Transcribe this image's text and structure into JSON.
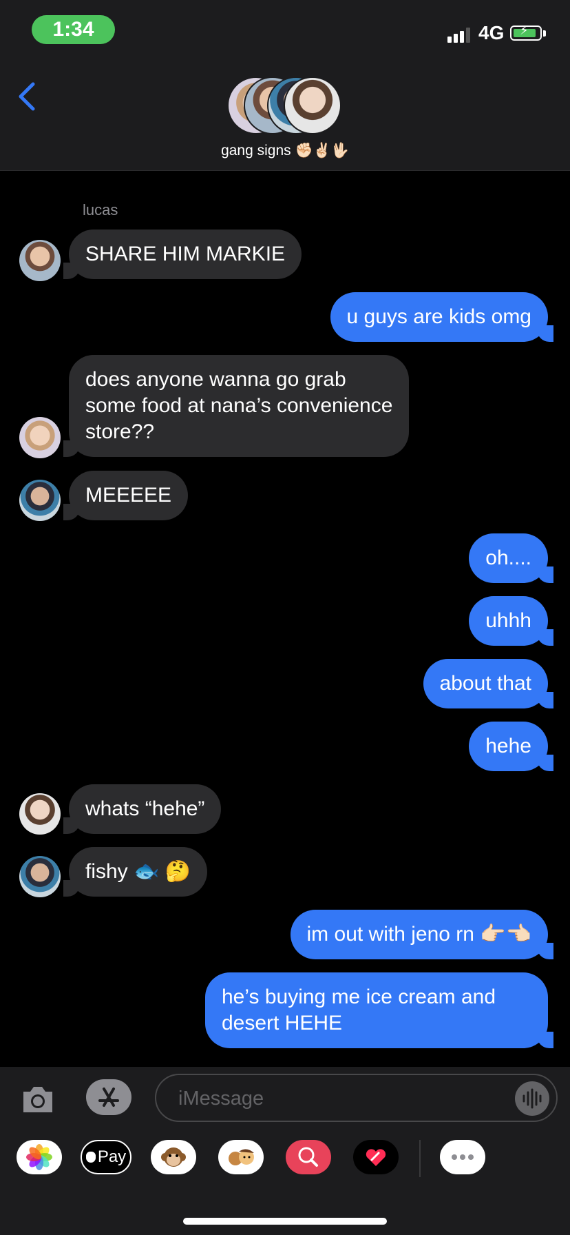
{
  "status_bar": {
    "time": "1:34",
    "network": "4G"
  },
  "header": {
    "group_name": "gang signs ✊🏻✌🏻🖖🏻",
    "back_icon": "chevron-left-icon"
  },
  "conversation": {
    "sender_label": "lucas",
    "messages": [
      {
        "direction": "in",
        "text": "SHARE HIM MARKIE"
      },
      {
        "direction": "out",
        "text": "u guys are kids omg"
      },
      {
        "direction": "in",
        "text": "does anyone wanna go grab\nsome food at nana’s convenience\nstore??"
      },
      {
        "direction": "in",
        "text": "MEEEEE"
      },
      {
        "direction": "out",
        "text": "oh...."
      },
      {
        "direction": "out",
        "text": "uhhh"
      },
      {
        "direction": "out",
        "text": "about that"
      },
      {
        "direction": "out",
        "text": "hehe"
      },
      {
        "direction": "in",
        "text": "whats “hehe”"
      },
      {
        "direction": "in",
        "text": "fishy 🐟 🤔"
      },
      {
        "direction": "out",
        "text": "im out with jeno rn 👉🏻👈🏻"
      },
      {
        "direction": "out",
        "text": "he’s buying me ice cream and\ndesert HEHE"
      }
    ]
  },
  "input_bar": {
    "placeholder": "iMessage",
    "apps": [
      "photos-icon",
      "apple-pay-icon",
      "animoji-icon",
      "memoji-icon",
      "image-search-icon",
      "digital-touch-icon",
      "more-apps-icon"
    ],
    "apple_pay_label": "Pay"
  },
  "colors": {
    "outgoing_bubble": "#3478f6",
    "incoming_bubble": "#2c2c2e",
    "time_pill": "#4cc35c",
    "background": "#000000"
  }
}
